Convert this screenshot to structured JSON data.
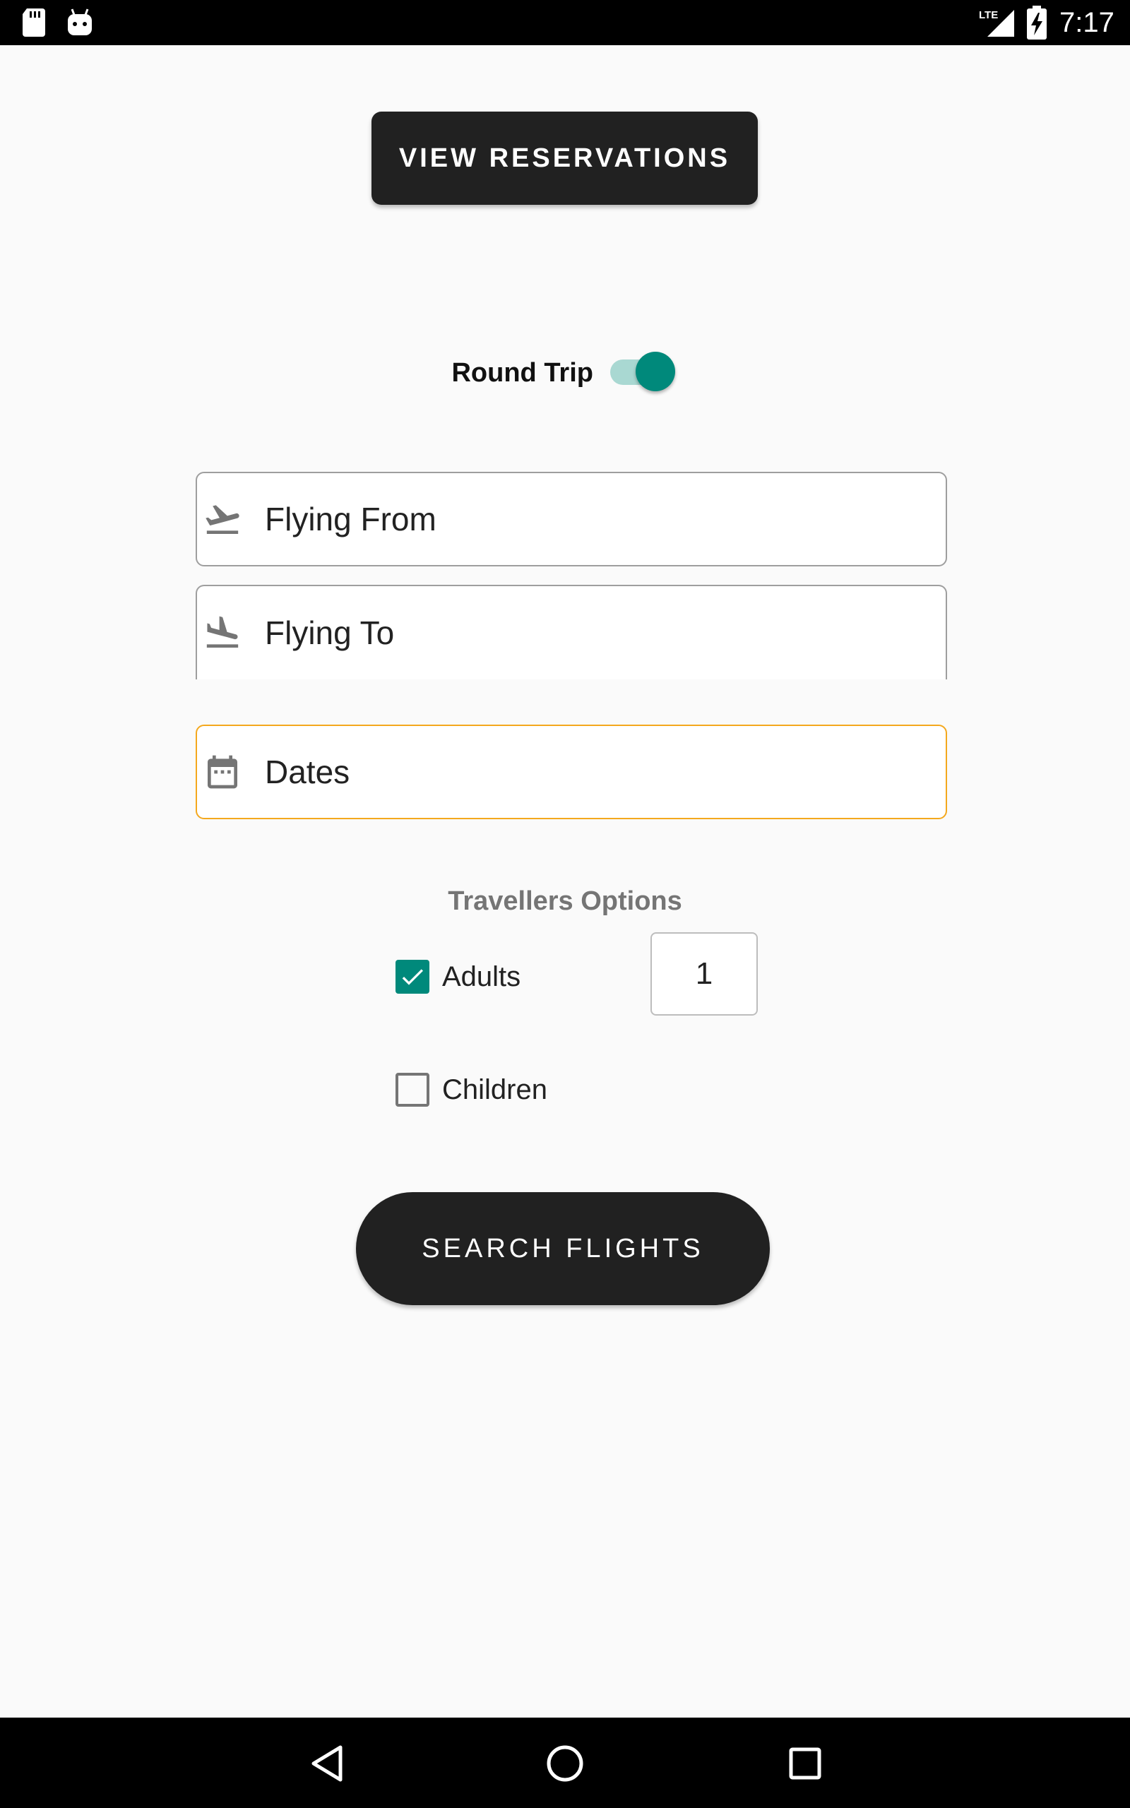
{
  "status_bar": {
    "time": "7:17",
    "icons": [
      "sd-card-icon",
      "android-icon",
      "lte-signal-icon",
      "battery-charging-icon"
    ]
  },
  "header": {
    "view_reservations_label": "VIEW RESERVATIONS"
  },
  "trip": {
    "round_trip_label": "Round Trip",
    "round_trip_enabled": true
  },
  "form": {
    "flying_from_placeholder": "Flying From",
    "flying_to_placeholder": "Flying To",
    "dates_placeholder": "Dates"
  },
  "travellers": {
    "title": "Travellers Options",
    "adults_label": "Adults",
    "adults_checked": true,
    "adults_count": "1",
    "children_label": "Children",
    "children_checked": false
  },
  "actions": {
    "search_label": "SEARCH FLIGHTS"
  },
  "colors": {
    "accent": "#00897b",
    "dark_button": "#212121",
    "focused_border": "#f4a81d"
  },
  "nav_bar": {
    "buttons": [
      "back-icon",
      "home-icon",
      "recents-icon"
    ]
  }
}
